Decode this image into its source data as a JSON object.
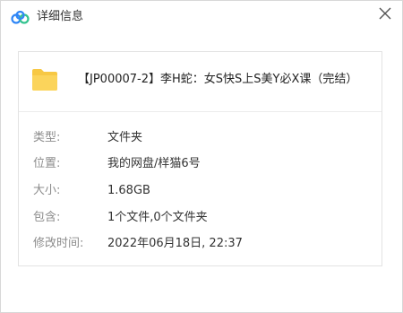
{
  "window": {
    "title": "详细信息",
    "icons": {
      "app": "cloud-logo-icon",
      "close": "close-icon"
    }
  },
  "file": {
    "icon": "folder-icon",
    "icon_color": "#f7c844",
    "name": "【JP00007-2】李H蛇：女S快S上S美Y必X课（完结）"
  },
  "details": [
    {
      "label": "类型:",
      "value": "文件夹"
    },
    {
      "label": "位置:",
      "value": "我的网盘/样猫6号"
    },
    {
      "label": "大小:",
      "value": "1.68GB"
    },
    {
      "label": "包含:",
      "value": "1个文件,0个文件夹"
    },
    {
      "label": "修改时间:",
      "value": "2022年06月18日, 22:37"
    }
  ],
  "colors": {
    "logo_blue": "#2f86f6",
    "logo_green": "#34c38f",
    "label_gray": "#8c8c8c"
  }
}
